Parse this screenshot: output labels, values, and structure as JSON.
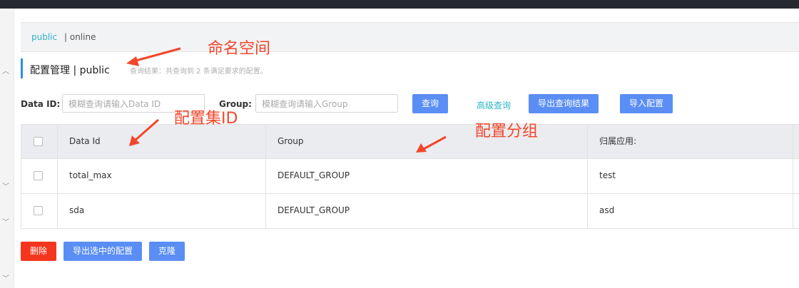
{
  "namespace_bar": {
    "active": "public",
    "other": "| online"
  },
  "page": {
    "title": "配置管理 | public",
    "result_text": "查询结果：共查询到 2 条满足要求的配置。"
  },
  "filters": {
    "data_id_label": "Data ID:",
    "data_id_placeholder": "模糊查询请输入Data ID",
    "group_label": "Group:",
    "group_placeholder": "模糊查询请输入Group",
    "query_button": "查询",
    "advanced_query_link": "高级查询",
    "export_query_button": "导出查询结果",
    "import_button": "导入配置"
  },
  "table": {
    "columns": [
      "Data Id",
      "Group",
      "归属应用:"
    ],
    "rows": [
      {
        "data_id": "total_max",
        "group": "DEFAULT_GROUP",
        "app": "test"
      },
      {
        "data_id": "sda",
        "group": "DEFAULT_GROUP",
        "app": "asd"
      }
    ]
  },
  "bottom_actions": {
    "delete": "删除",
    "export_selected": "导出选中的配置",
    "clone": "克隆"
  },
  "annotations": {
    "namespace": "命名空间",
    "config_id": "配置集ID",
    "config_group": "配置分组"
  },
  "colors": {
    "accent": "#2eb4c8",
    "primary_button": "#5a8ef5",
    "danger_button": "#f5361e",
    "annotation": "#f2472a"
  }
}
